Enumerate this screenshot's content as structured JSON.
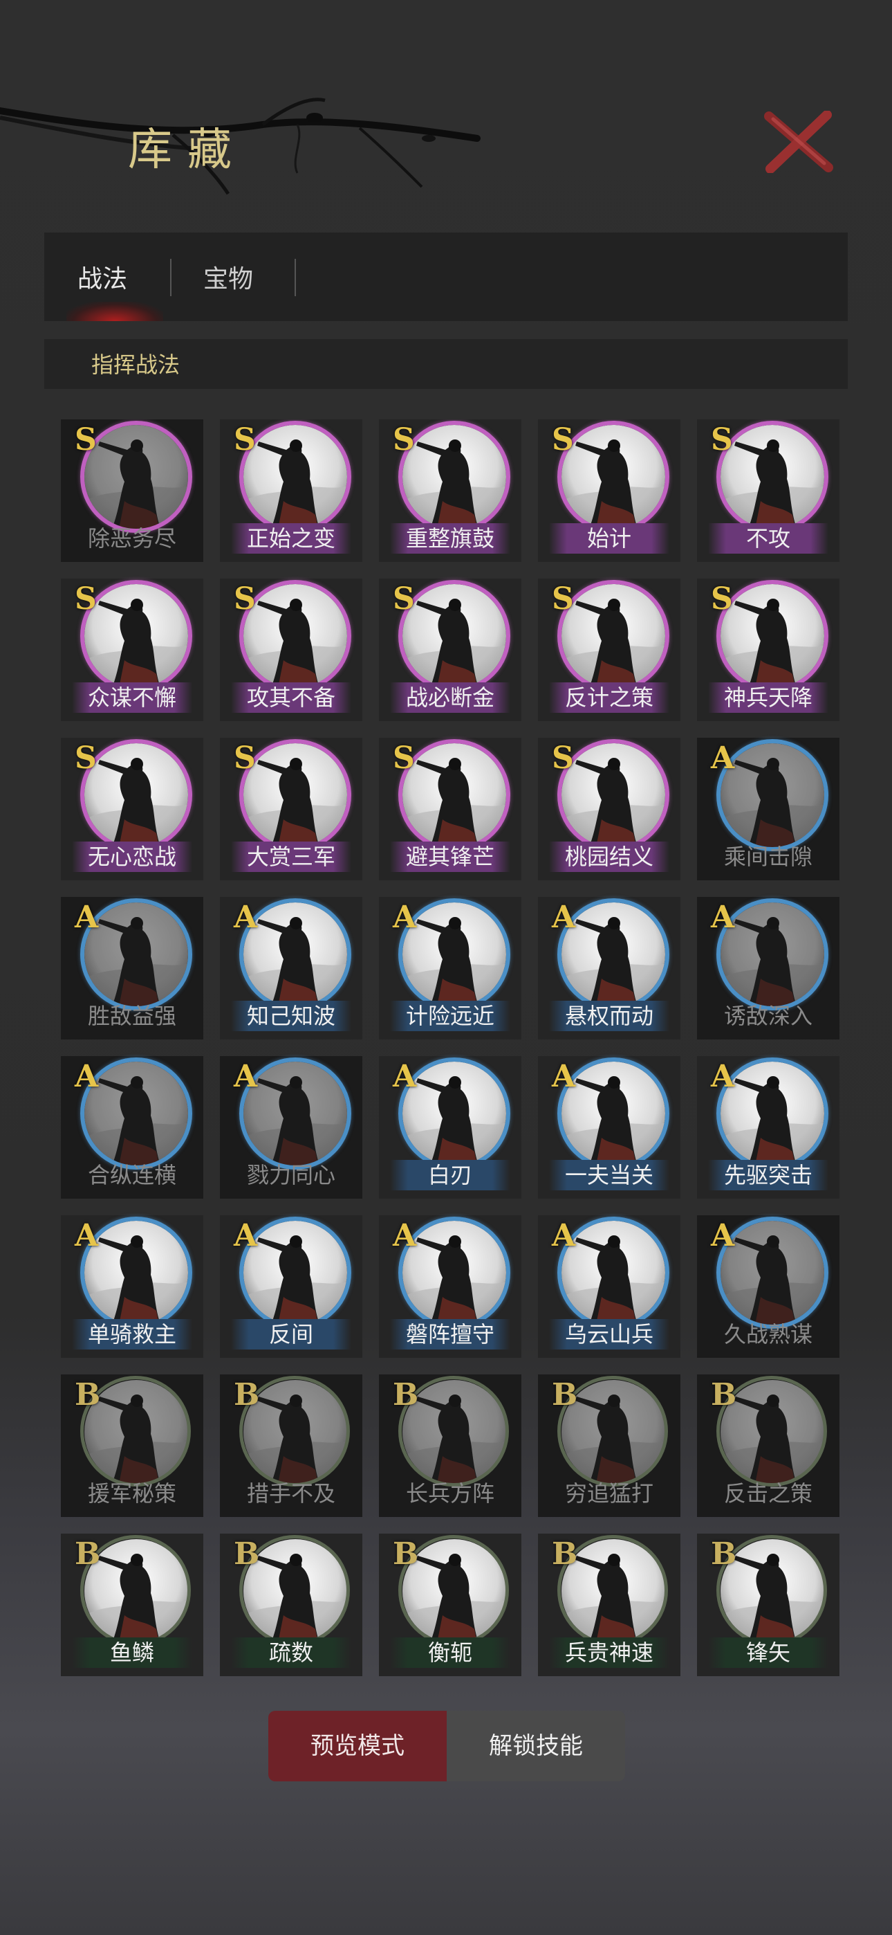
{
  "header": {
    "title": "库藏",
    "close_icon": "close-x-icon"
  },
  "tabs": [
    {
      "label": "战法"
    },
    {
      "label": "宝物"
    }
  ],
  "subheader": {
    "label": "指挥战法"
  },
  "skills": [
    {
      "name": "除恶务尽",
      "grade": "S",
      "dim": true
    },
    {
      "name": "正始之变",
      "grade": "S",
      "dim": false
    },
    {
      "name": "重整旗鼓",
      "grade": "S",
      "dim": false
    },
    {
      "name": "始计",
      "grade": "S",
      "dim": false
    },
    {
      "name": "不攻",
      "grade": "S",
      "dim": false
    },
    {
      "name": "众谋不懈",
      "grade": "S",
      "dim": false
    },
    {
      "name": "攻其不备",
      "grade": "S",
      "dim": false
    },
    {
      "name": "战必断金",
      "grade": "S",
      "dim": false
    },
    {
      "name": "反计之策",
      "grade": "S",
      "dim": false
    },
    {
      "name": "神兵天降",
      "grade": "S",
      "dim": false
    },
    {
      "name": "无心恋战",
      "grade": "S",
      "dim": false
    },
    {
      "name": "大赏三军",
      "grade": "S",
      "dim": false
    },
    {
      "name": "避其锋芒",
      "grade": "S",
      "dim": false
    },
    {
      "name": "桃园结义",
      "grade": "S",
      "dim": false
    },
    {
      "name": "乘间击隙",
      "grade": "A",
      "dim": true
    },
    {
      "name": "胜敌益强",
      "grade": "A",
      "dim": true
    },
    {
      "name": "知己知波",
      "grade": "A",
      "dim": false
    },
    {
      "name": "计险远近",
      "grade": "A",
      "dim": false
    },
    {
      "name": "悬权而动",
      "grade": "A",
      "dim": false
    },
    {
      "name": "诱敌深入",
      "grade": "A",
      "dim": true
    },
    {
      "name": "合纵连横",
      "grade": "A",
      "dim": true
    },
    {
      "name": "戮力同心",
      "grade": "A",
      "dim": true
    },
    {
      "name": "白刃",
      "grade": "A",
      "dim": false
    },
    {
      "name": "一夫当关",
      "grade": "A",
      "dim": false
    },
    {
      "name": "先驱突击",
      "grade": "A",
      "dim": false
    },
    {
      "name": "单骑救主",
      "grade": "A",
      "dim": false
    },
    {
      "name": "反间",
      "grade": "A",
      "dim": false
    },
    {
      "name": "磐阵擅守",
      "grade": "A",
      "dim": false
    },
    {
      "name": "乌云山兵",
      "grade": "A",
      "dim": false
    },
    {
      "name": "久战熟谋",
      "grade": "A",
      "dim": true
    },
    {
      "name": "援军秘策",
      "grade": "B",
      "dim": true
    },
    {
      "name": "措手不及",
      "grade": "B",
      "dim": true
    },
    {
      "name": "长兵方阵",
      "grade": "B",
      "dim": true
    },
    {
      "name": "穷追猛打",
      "grade": "B",
      "dim": true
    },
    {
      "name": "反击之策",
      "grade": "B",
      "dim": true
    },
    {
      "name": "鱼鳞",
      "grade": "B",
      "dim": false
    },
    {
      "name": "疏数",
      "grade": "B",
      "dim": false
    },
    {
      "name": "衡轭",
      "grade": "B",
      "dim": false
    },
    {
      "name": "兵贵神速",
      "grade": "B",
      "dim": false
    },
    {
      "name": "锋矢",
      "grade": "B",
      "dim": false
    }
  ],
  "footer": {
    "preview_label": "预览模式",
    "unlock_label": "解锁技能"
  }
}
